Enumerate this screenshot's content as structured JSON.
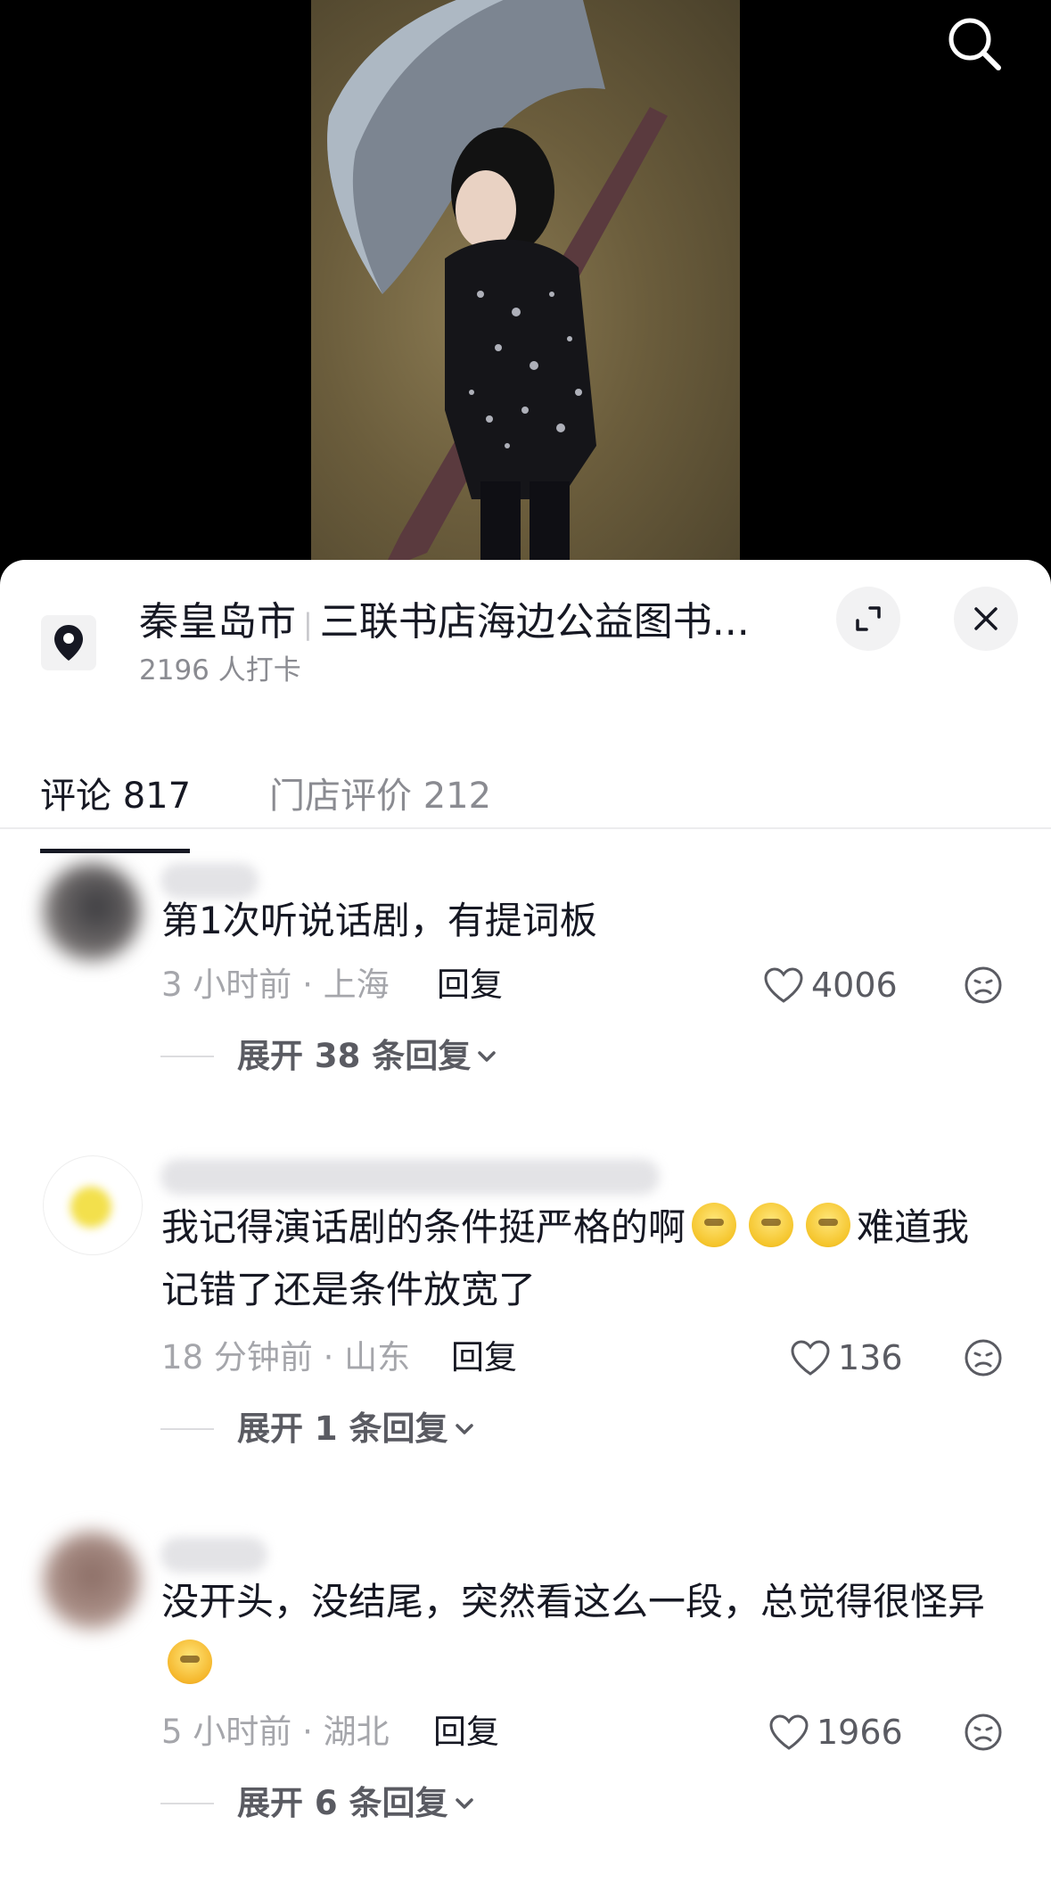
{
  "video": {
    "search_icon": "search-icon"
  },
  "location": {
    "city": "秦皇岛市",
    "place": "三联书店海边公益图书...",
    "checkins": "2196 人打卡"
  },
  "tabs": [
    {
      "label": "评论 817",
      "active": true
    },
    {
      "label": "门店评价 212",
      "active": false
    }
  ],
  "comments": [
    {
      "text": "第1次听说话剧，有提词板",
      "meta": "3 小时前 · 上海",
      "reply_label": "回复",
      "likes": "4006",
      "expand_label": "展开 38 条回复"
    },
    {
      "text_before": "我记得演话剧的条件挺严格的啊",
      "text_after": "难道我记错了还是条件放宽了",
      "meta": "18 分钟前 · 山东",
      "reply_label": "回复",
      "likes": "136",
      "expand_label": "展开 1 条回复"
    },
    {
      "text": "没开头，没结尾，突然看这么一段，总觉得很怪异",
      "meta": "5 小时前 · 湖北",
      "reply_label": "回复",
      "likes": "1966",
      "expand_label": "展开 6 条回复"
    }
  ],
  "colors": {
    "primary_text": "#161823",
    "secondary_text": "#8a8b91",
    "meta_text": "#a5a6ab",
    "panel_bg": "#ffffff"
  }
}
